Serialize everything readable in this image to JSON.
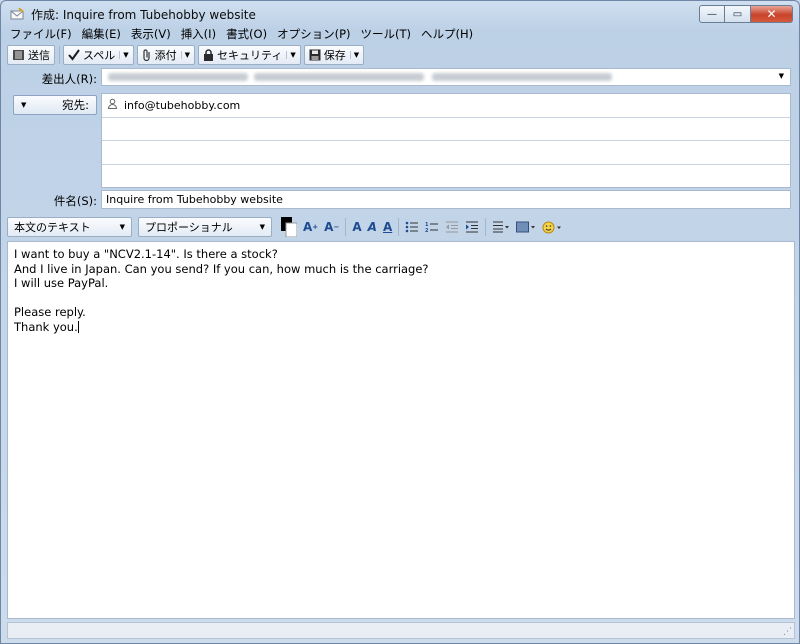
{
  "window": {
    "title": "作成: Inquire from Tubehobby website",
    "controls": {
      "minimize": "—",
      "maximize": "▭",
      "close": "✕"
    }
  },
  "menu": [
    {
      "label": "ファイル(F)"
    },
    {
      "label": "編集(E)"
    },
    {
      "label": "表示(V)"
    },
    {
      "label": "挿入(I)"
    },
    {
      "label": "書式(O)"
    },
    {
      "label": "オプション(P)"
    },
    {
      "label": "ツール(T)"
    },
    {
      "label": "ヘルプ(H)"
    }
  ],
  "toolbar": {
    "send": "送信",
    "spell": "スペル",
    "attach": "添付",
    "security": "セキュリティ",
    "save": "保存"
  },
  "fields": {
    "from_label": "差出人(R):",
    "to_button": "宛先:",
    "recipients": [
      "info@tubehobby.com",
      "",
      "",
      ""
    ],
    "subject_label": "件名(S):",
    "subject_value": "Inquire from Tubehobby website"
  },
  "format": {
    "paragraph_style": "本文のテキスト",
    "font": "プロポーショナル"
  },
  "body": {
    "lines": [
      "I want to buy a \"NCV2.1-14\". Is there a stock?",
      "And I live in Japan. Can you send? If you can, how much is the carriage?",
      "I will use PayPal.",
      "",
      "Please reply.",
      "Thank you."
    ]
  },
  "colors": {
    "accent": "#1f4b91",
    "window_bg": "#c9d8ea",
    "close": "#c8432b"
  }
}
